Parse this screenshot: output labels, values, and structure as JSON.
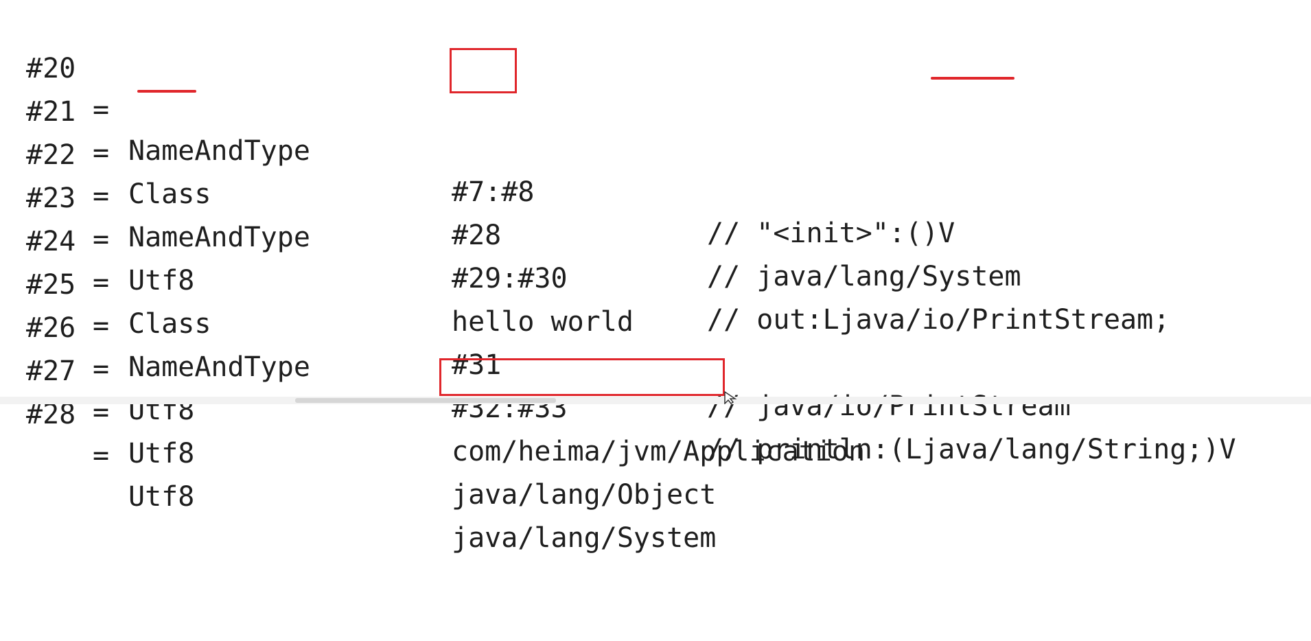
{
  "constant_pool": [
    {
      "index": "#20",
      "eq": "=",
      "type": "NameAndType",
      "ref": "#7:#8",
      "comment": "// \"<init>\":()V"
    },
    {
      "index": "#21",
      "eq": "=",
      "type": "Class",
      "ref": "#28",
      "comment": "// java/lang/System"
    },
    {
      "index": "#22",
      "eq": "=",
      "type": "NameAndType",
      "ref": "#29:#30",
      "comment": "// out:Ljava/io/PrintStream;"
    },
    {
      "index": "#23",
      "eq": "=",
      "type": "Utf8",
      "ref": "hello world",
      "comment": ""
    },
    {
      "index": "#24",
      "eq": "=",
      "type": "Class",
      "ref": "#31",
      "comment": "// java/io/PrintStream"
    },
    {
      "index": "#25",
      "eq": "=",
      "type": "NameAndType",
      "ref": "#32:#33",
      "comment": "// println:(Ljava/lang/String;)V"
    },
    {
      "index": "#26",
      "eq": "=",
      "type": "Utf8",
      "ref": "com/heima/jvm/Application",
      "comment": ""
    },
    {
      "index": "#27",
      "eq": "=",
      "type": "Utf8",
      "ref": "java/lang/Object",
      "comment": ""
    },
    {
      "index": "#28",
      "eq": "=",
      "type": "Utf8",
      "ref": "java/lang/System",
      "comment": ""
    }
  ],
  "annotation_color": "#e0262b",
  "icons": {
    "cursor": "arrow-cursor-icon"
  }
}
